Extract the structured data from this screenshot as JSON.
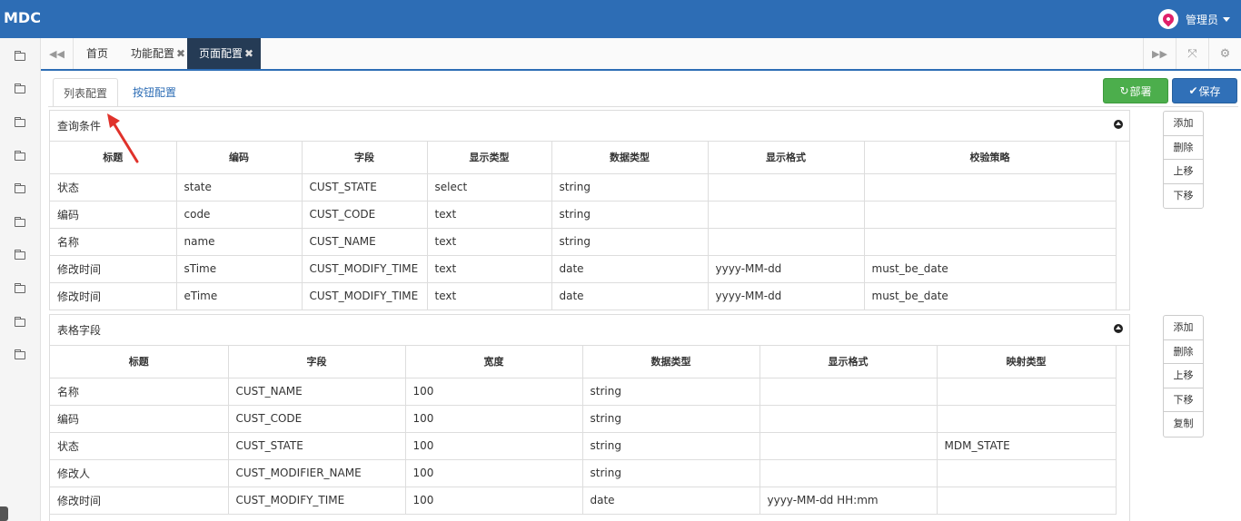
{
  "app": {
    "logo": "MDC",
    "user": "管理员"
  },
  "page_tabs": [
    {
      "label": "首页",
      "closable": false
    },
    {
      "label": "功能配置",
      "closable": true
    },
    {
      "label": "页面配置",
      "closable": true,
      "active": true
    }
  ],
  "close_glyph": "✖",
  "sub_tabs": [
    "列表配置",
    "按钮配置"
  ],
  "toolbar": {
    "deploy_label": "部署",
    "save_label": "保存"
  },
  "query": {
    "title": "查询条件",
    "headers": [
      "标题",
      "编码",
      "字段",
      "显示类型",
      "数据类型",
      "显示格式",
      "校验策略"
    ],
    "rows": [
      [
        "状态",
        "state",
        "CUST_STATE",
        "select",
        "string",
        "",
        ""
      ],
      [
        "编码",
        "code",
        "CUST_CODE",
        "text",
        "string",
        "",
        ""
      ],
      [
        "名称",
        "name",
        "CUST_NAME",
        "text",
        "string",
        "",
        ""
      ],
      [
        "修改时间",
        "sTime",
        "CUST_MODIFY_TIME",
        "text",
        "date",
        "yyyy-MM-dd",
        "must_be_date"
      ],
      [
        "修改时间",
        "eTime",
        "CUST_MODIFY_TIME",
        "text",
        "date",
        "yyyy-MM-dd",
        "must_be_date"
      ]
    ],
    "actions": [
      "添加",
      "删除",
      "上移",
      "下移"
    ]
  },
  "grid": {
    "title": "表格字段",
    "headers": [
      "标题",
      "字段",
      "宽度",
      "数据类型",
      "显示格式",
      "映射类型"
    ],
    "rows": [
      [
        "名称",
        "CUST_NAME",
        "100",
        "string",
        "",
        ""
      ],
      [
        "编码",
        "CUST_CODE",
        "100",
        "string",
        "",
        ""
      ],
      [
        "状态",
        "CUST_STATE",
        "100",
        "string",
        "",
        "MDM_STATE"
      ],
      [
        "修改人",
        "CUST_MODIFIER_NAME",
        "100",
        "string",
        "",
        ""
      ],
      [
        "修改时间",
        "CUST_MODIFY_TIME",
        "100",
        "date",
        "yyyy-MM-dd HH:mm",
        ""
      ]
    ],
    "actions": [
      "添加",
      "删除",
      "上移",
      "下移",
      "复制"
    ]
  },
  "sidebar_icons": [
    "folder-icon",
    "folder-icon",
    "folder-icon",
    "folder-icon",
    "folder-icon",
    "folder-icon",
    "folder-icon",
    "folder-icon",
    "folder-icon",
    "folder-icon"
  ]
}
